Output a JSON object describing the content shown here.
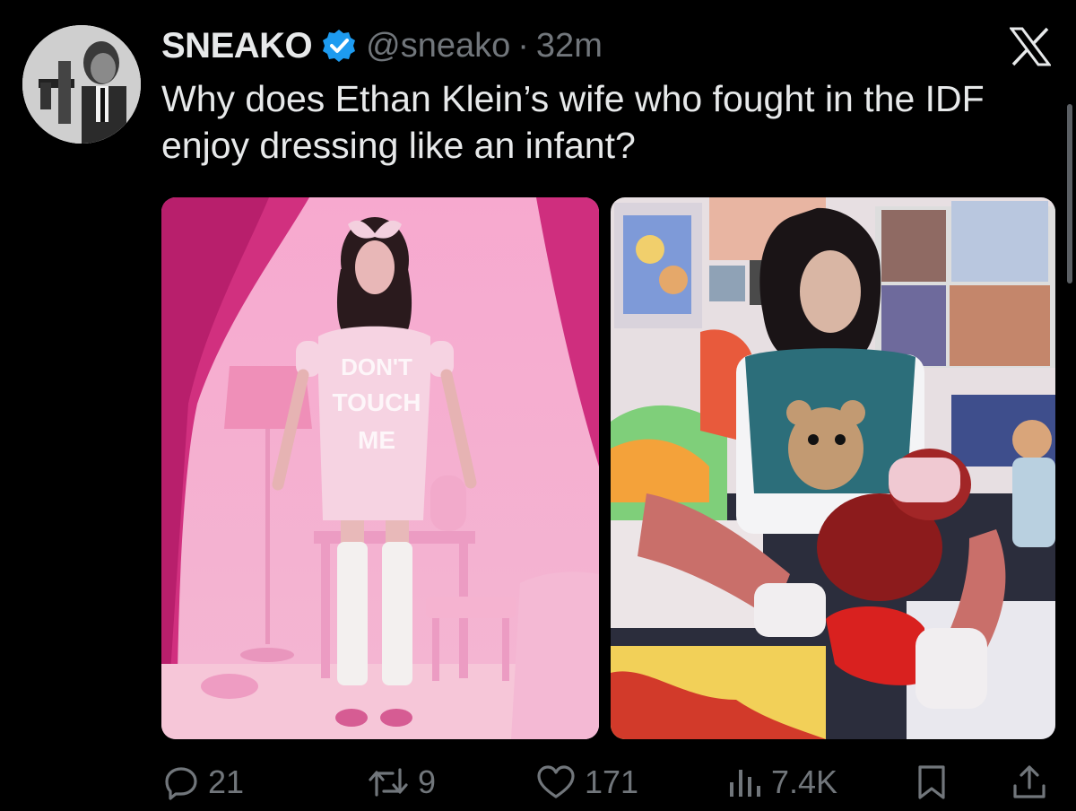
{
  "tweet": {
    "author_name": "SNEAKO",
    "handle": "@sneako",
    "separator": "·",
    "time": "32m",
    "text": "Why does Ethan Klein’s wife who fought in the IDF enjoy dressing like an infant?"
  },
  "media": {
    "left": {
      "shirt_text": [
        "DON'T",
        "TOUCH",
        "ME"
      ]
    },
    "right": {}
  },
  "actions": {
    "replies": "21",
    "reposts": "9",
    "likes": "171",
    "views": "7.4K"
  },
  "colors": {
    "background": "#000000",
    "text_primary": "#e7e9ea",
    "text_secondary": "#71767b",
    "verified": "#1d9bf0"
  },
  "icons": [
    "verified-badge-icon",
    "x-logo-icon",
    "reply-icon",
    "repost-icon",
    "like-icon",
    "views-icon",
    "bookmark-icon",
    "share-icon"
  ]
}
